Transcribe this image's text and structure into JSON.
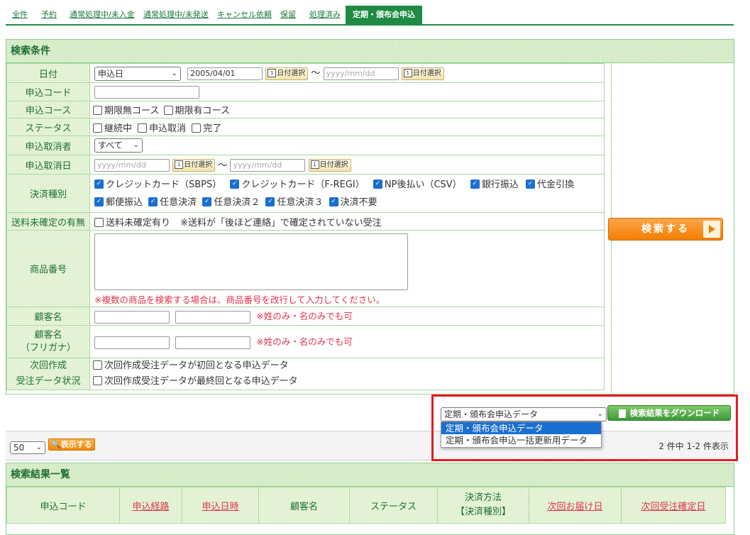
{
  "tabs": [
    "全件",
    "予約",
    "通常処理中/未入金",
    "通常処理中/未発送",
    "キャンセル依頼",
    "保留",
    "処理済み",
    "定期・頒布会申込"
  ],
  "search_panel": {
    "title": "検索条件",
    "date": {
      "label": "日付",
      "type_value": "申込日",
      "from_value": "2005/04/01",
      "to_placeholder": "yyyy/mm/dd",
      "date_button": "日付選択",
      "tilde": "～"
    },
    "apply_code": {
      "label": "申込コード"
    },
    "course": {
      "label": "申込コース",
      "options": [
        "期限無コース",
        "期限有コース"
      ]
    },
    "status": {
      "label": "ステータス",
      "options": [
        "継続中",
        "申込取消",
        "完了"
      ]
    },
    "canceller": {
      "label": "申込取消者",
      "value": "すべて"
    },
    "cancel_date": {
      "label": "申込取消日",
      "from_placeholder": "yyyy/mm/dd",
      "to_placeholder": "yyyy/mm/dd"
    },
    "payment": {
      "label": "決済種別",
      "row1": [
        "クレジットカード（SBPS）",
        "クレジットカード（F-REGI）",
        "NP後払い（CSV）",
        "銀行振込",
        "代金引換"
      ],
      "row2": [
        "郵便振込",
        "任意決済",
        "任意決済２",
        "任意決済３",
        "決済不要"
      ]
    },
    "shipping": {
      "label": "送料未確定の有無",
      "option": "送料未確定有り",
      "note": "※送料が「後ほど連絡」で確定されていない受注"
    },
    "product": {
      "label": "商品番号",
      "note": "※複数の商品を検索する場合は、商品番号を改行して入力してください。"
    },
    "customer": {
      "label": "顧客名",
      "note": "※姓のみ・名のみでも可"
    },
    "customer_kana": {
      "label1": "顧客名",
      "label2": "（フリガナ）",
      "note": "※姓のみ・名のみでも可"
    },
    "next_order": {
      "label1": "次回作成",
      "label2": "受注データ状況",
      "opt1": "次回作成受注データが初回となる申込データ",
      "opt2": "次回作成受注データが最終回となる申込データ"
    },
    "search_button": "検索する"
  },
  "download": {
    "selected": "定期・頒布会申込データ",
    "options": [
      "定期・頒布会申込データ",
      "定期・頒布会申込一括更新用データ"
    ],
    "button": "検索結果をダウンロード"
  },
  "pager": {
    "per_page": "50",
    "show_button": "表示する",
    "count": "2 件中 1-2 件表示"
  },
  "results": {
    "title": "検索結果一覧",
    "columns": [
      {
        "label": "申込コード",
        "link": false
      },
      {
        "label": "申込経路",
        "link": true
      },
      {
        "label": "申込日時",
        "link": true
      },
      {
        "label": "顧客名",
        "link": false
      },
      {
        "label": "ステータス",
        "link": false
      },
      {
        "label": "決済方法",
        "label2": "【決済種別】",
        "link": false
      },
      {
        "label": "次回お届け日",
        "link": true
      },
      {
        "label": "次回受注確定日",
        "link": true
      }
    ]
  },
  "colors": {
    "accent_green": "#1e8a43",
    "highlight_red": "#e31b23",
    "search_orange": "#f27f00",
    "note_red": "#e0324b"
  }
}
